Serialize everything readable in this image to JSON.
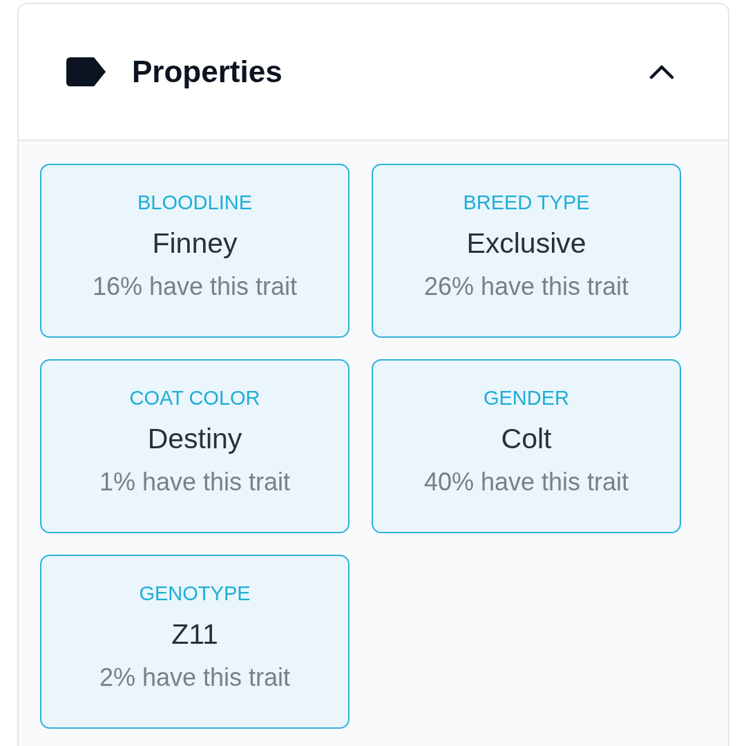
{
  "panel": {
    "title": "Properties",
    "expanded": true
  },
  "traits": [
    {
      "label": "BLOODLINE",
      "value": "Finney",
      "share": "16% have this trait"
    },
    {
      "label": "BREED TYPE",
      "value": "Exclusive",
      "share": "26% have this trait"
    },
    {
      "label": "COAT COLOR",
      "value": "Destiny",
      "share": "1% have this trait"
    },
    {
      "label": "GENDER",
      "value": "Colt",
      "share": "40% have this trait"
    },
    {
      "label": "GENOTYPE",
      "value": "Z11",
      "share": "2% have this trait"
    }
  ]
}
